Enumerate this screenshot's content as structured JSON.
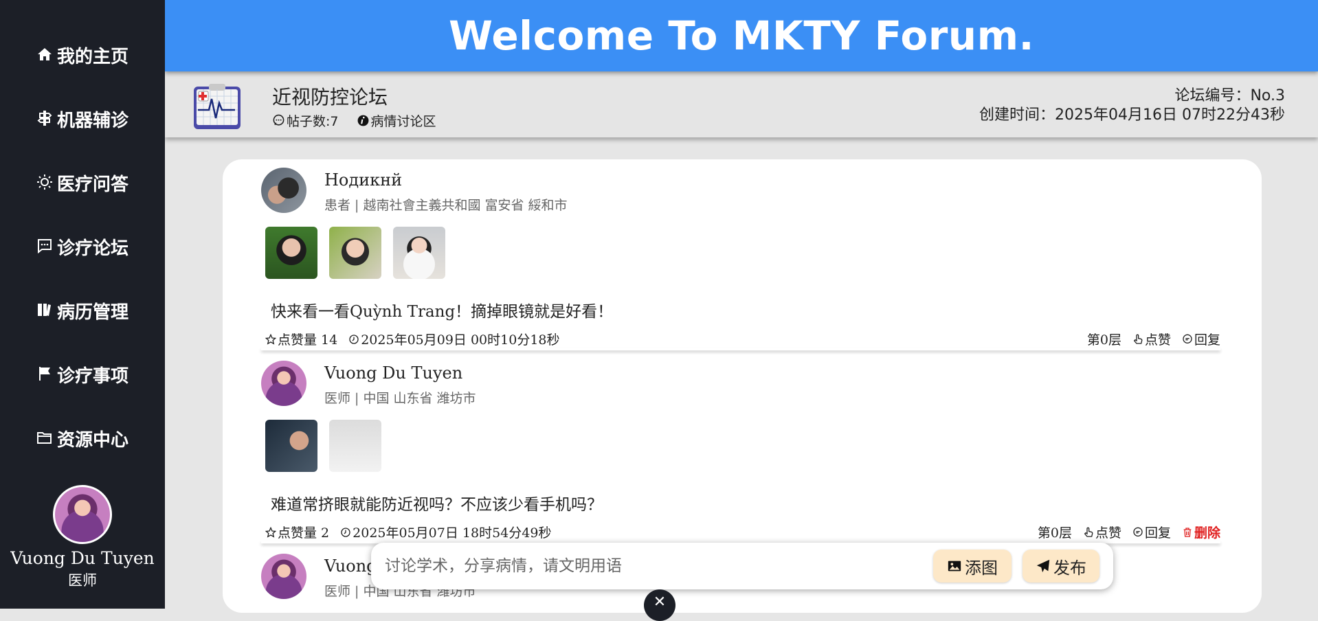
{
  "banner": {
    "title": "Welcome To MKTY Forum."
  },
  "sidebar": {
    "items": [
      {
        "label": "我的主页",
        "icon": "home-icon"
      },
      {
        "label": "机器辅诊",
        "icon": "signpost-icon"
      },
      {
        "label": "医疗问答",
        "icon": "sun-icon"
      },
      {
        "label": "诊疗论坛",
        "icon": "chat-icon"
      },
      {
        "label": "病历管理",
        "icon": "book-icon"
      },
      {
        "label": "诊疗事项",
        "icon": "flag-icon"
      },
      {
        "label": "资源中心",
        "icon": "folder-icon"
      }
    ],
    "user": {
      "name": "Vuong Du Tuyen",
      "role": "医师"
    }
  },
  "forum": {
    "title": "近视防控论坛",
    "post_count": "帖子数:7",
    "category": "病情讨论区",
    "number": "论坛编号：No.3",
    "created": "创建时间：2025年04月16日 07时22分43秒"
  },
  "posts": [
    {
      "author": "Нодикнй",
      "info": "患者 | 越南社會主義共和國 富安省 綏和市",
      "content": "快来看一看Quỳnh Trang！摘掉眼镜就是好看！",
      "likes": "点赞量 14",
      "time": "2025年05月09日 00时10分18秒",
      "floor": "第0层",
      "like_label": "点赞",
      "reply_label": "回复"
    },
    {
      "author": "Vuong Du Tuyen",
      "info": "医师 | 中国 山东省 潍坊市",
      "content": "难道常挤眼就能防近视吗？不应该少看手机吗？",
      "likes": "点赞量 2",
      "time": "2025年05月07日 18时54分49秒",
      "floor": "第0层",
      "like_label": "点赞",
      "reply_label": "回复",
      "delete_label": "删除"
    },
    {
      "author": "Vuong Du Tuyen",
      "info": "医师 | 中国 山东省 潍坊市"
    }
  ],
  "composer": {
    "placeholder": "讨论学术，分享病情，请文明用语",
    "add_image_label": "添图",
    "send_label": "发布"
  },
  "colors": {
    "banner": "#3b8ff5",
    "sidebar": "#1c1f27",
    "delete": "#e02020",
    "button_bg": "#fde8c8"
  }
}
